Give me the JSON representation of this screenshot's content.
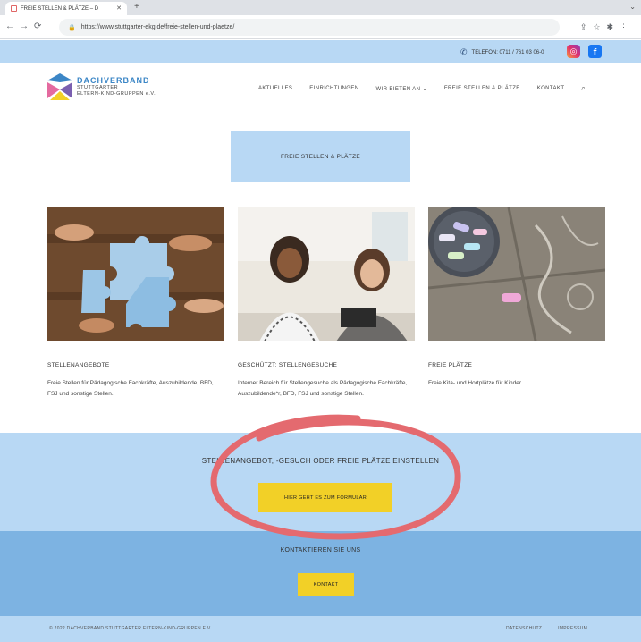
{
  "browser": {
    "tab_title": "FREIE STELLEN & PLÄTZE – D",
    "url": "https://www.stuttgarter-ekg.de/freie-stellen-und-plaetze/"
  },
  "topbar": {
    "phone": "TELEFON: 0711 / 761 03 06-0"
  },
  "logo": {
    "line1": "DACHVERBAND",
    "line2": "STUTTGARTER",
    "line3": "ELTERN-KIND-GRUPPEN e.V."
  },
  "nav": {
    "items": [
      {
        "label": "AKTUELLES"
      },
      {
        "label": "EINRICHTUNGEN"
      },
      {
        "label": "WIR BIETEN AN ⌄"
      },
      {
        "label": "FREIE STELLEN & PLÄTZE"
      },
      {
        "label": "KONTAKT"
      }
    ]
  },
  "page": {
    "title": "FREIE STELLEN & PLÄTZE"
  },
  "cards": [
    {
      "title": "STELLENANGEBOTE",
      "text": "Freie Stellen für Pädagogische Fachkräfte, Auszubildende, BFD, FSJ und sonstige Stellen."
    },
    {
      "title": "GESCHÜTZT: STELLENGESUCHE",
      "text": "Interner Bereich für Stellengesuche als Pädagogische Fachkräfte, Auszubildende*r, BFD, FSJ und sonstige Stellen."
    },
    {
      "title": "FREIE PLÄTZE",
      "text": "Freie Kita- und Hortplätze für Kinder."
    }
  ],
  "cta": {
    "title": "STELLENANGEBOT, -GESUCH ODER FREIE PLÄTZE EINSTELLEN",
    "button": "HIER GEHT ES ZUM FORMULAR"
  },
  "contact": {
    "title": "KONTAKTIEREN SIE UNS",
    "button": "KONTAKT"
  },
  "footer": {
    "copyright": "© 2022 DACHVERBAND STUTTGARTER ELTERN-KIND-GRUPPEN E.V.",
    "links": [
      "DATENSCHUTZ",
      "IMPRESSUM"
    ]
  },
  "colors": {
    "light_blue": "#b8d8f4",
    "mid_blue": "#7db3e2",
    "yellow": "#f2d027",
    "annotation_red": "#e46a6f"
  }
}
